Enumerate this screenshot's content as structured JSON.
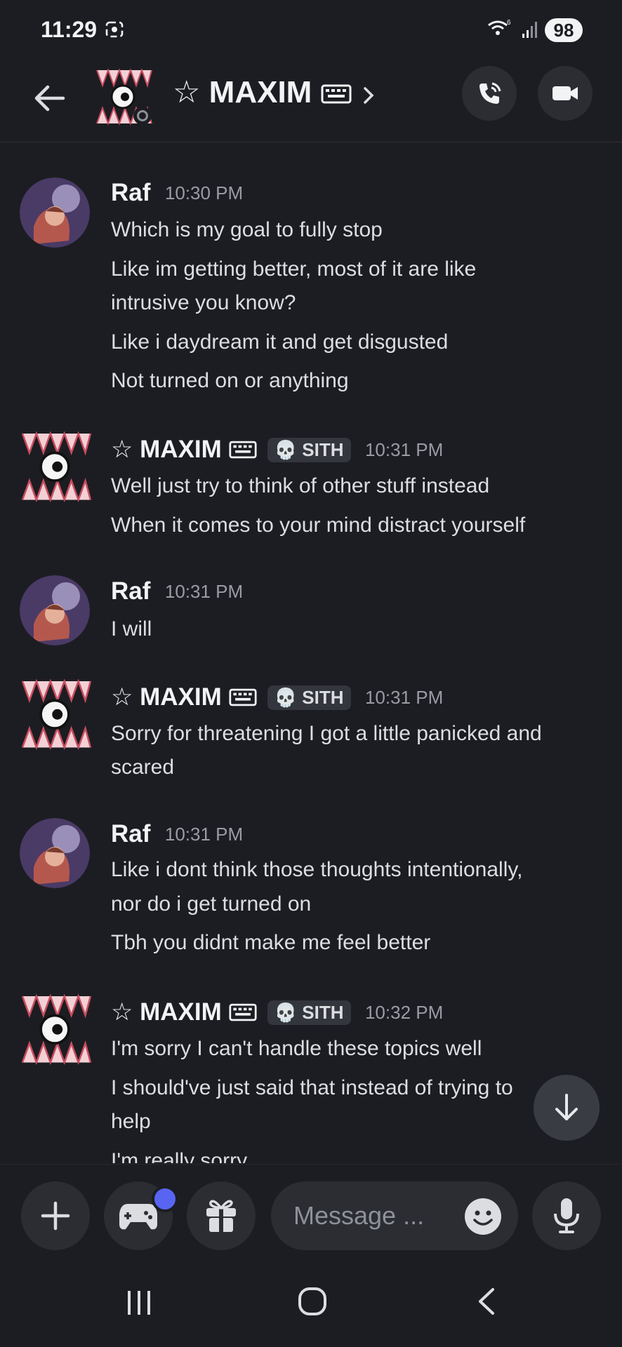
{
  "status_bar": {
    "time": "11:29",
    "battery": "98"
  },
  "header": {
    "channel_name": "☆ MAXIM"
  },
  "messages": [
    {
      "author": "Raf",
      "time": "10:30 PM",
      "lines": [
        "Which is my goal to fully stop",
        "Like im getting better, most of it are like",
        "intrusive you know?",
        "Like i daydream it and get disgusted",
        "Not turned on or anything"
      ]
    },
    {
      "author": "☆ MAXIM",
      "tag": "SITH",
      "time": "10:31 PM",
      "lines": [
        "Well just try to think of other stuff instead",
        "When it comes to your mind distract yourself"
      ]
    },
    {
      "author": "Raf",
      "time": "10:31 PM",
      "lines": [
        "I will"
      ]
    },
    {
      "author": "☆ MAXIM",
      "tag": "SITH",
      "time": "10:31 PM",
      "lines": [
        "Sorry for threatening I got a little panicked and",
        "scared"
      ]
    },
    {
      "author": "Raf",
      "time": "10:31 PM",
      "lines": [
        "Like i dont think those thoughts intentionally,",
        "nor do i get turned on",
        "Tbh you didnt make me feel better"
      ]
    },
    {
      "author": "☆ MAXIM",
      "tag": "SITH",
      "time": "10:32 PM",
      "lines": [
        "I'm sorry I can't handle these topics well",
        "I should've just said that instead of trying to",
        "help",
        "I'm really sorry"
      ]
    }
  ],
  "composer": {
    "placeholder": "Message ..."
  },
  "colors": {
    "background": "#1c1d22",
    "accent": "#5865f2",
    "surface": "#2b2d33"
  }
}
